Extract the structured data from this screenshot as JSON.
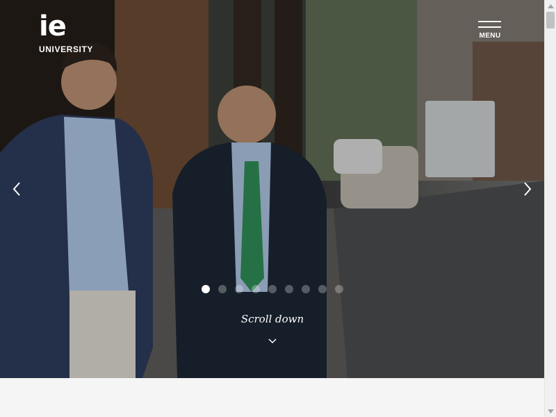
{
  "brand": {
    "mark": "ie",
    "word": "UNIVERSITY"
  },
  "header": {
    "menu_label": "MENU"
  },
  "hero": {
    "slide_count": 9,
    "active_slide_index": 0,
    "scroll_label": "Scroll down"
  },
  "icons": {
    "prev": "chevron-left-icon",
    "next": "chevron-right-icon",
    "scroll": "chevron-down-icon",
    "menu": "hamburger-icon"
  },
  "colors": {
    "overlay_text": "#ffffff",
    "page_background": "#f5f5f5",
    "dot_inactive": "rgba(255,255,255,0.28)",
    "dot_active": "#ffffff"
  }
}
